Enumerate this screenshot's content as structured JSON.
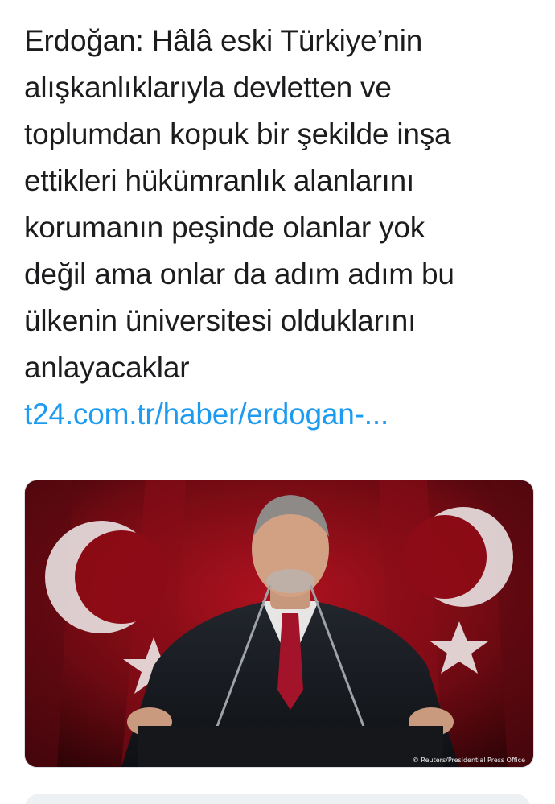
{
  "tweet": {
    "text_lines": [
      "Erdoğan: Hâlâ eski Türkiye’nin",
      "alışkanlıklarıyla devletten ve",
      "toplumdan kopuk bir şekilde inşa",
      "ettikleri hükümranlık alanlarını",
      "korumanın peşinde olanlar yok",
      "değil ama onlar da adım adım bu",
      "ülkenin üniversitesi olduklarını",
      "anlayacaklar"
    ],
    "link": "t24.com.tr/haber/erdogan-...",
    "media": {
      "credit": "© Reuters/Presidential Press Office"
    }
  },
  "colors": {
    "text": "#1c1c1e",
    "link": "#1d9bf0",
    "flag_red": "#c8102e"
  }
}
